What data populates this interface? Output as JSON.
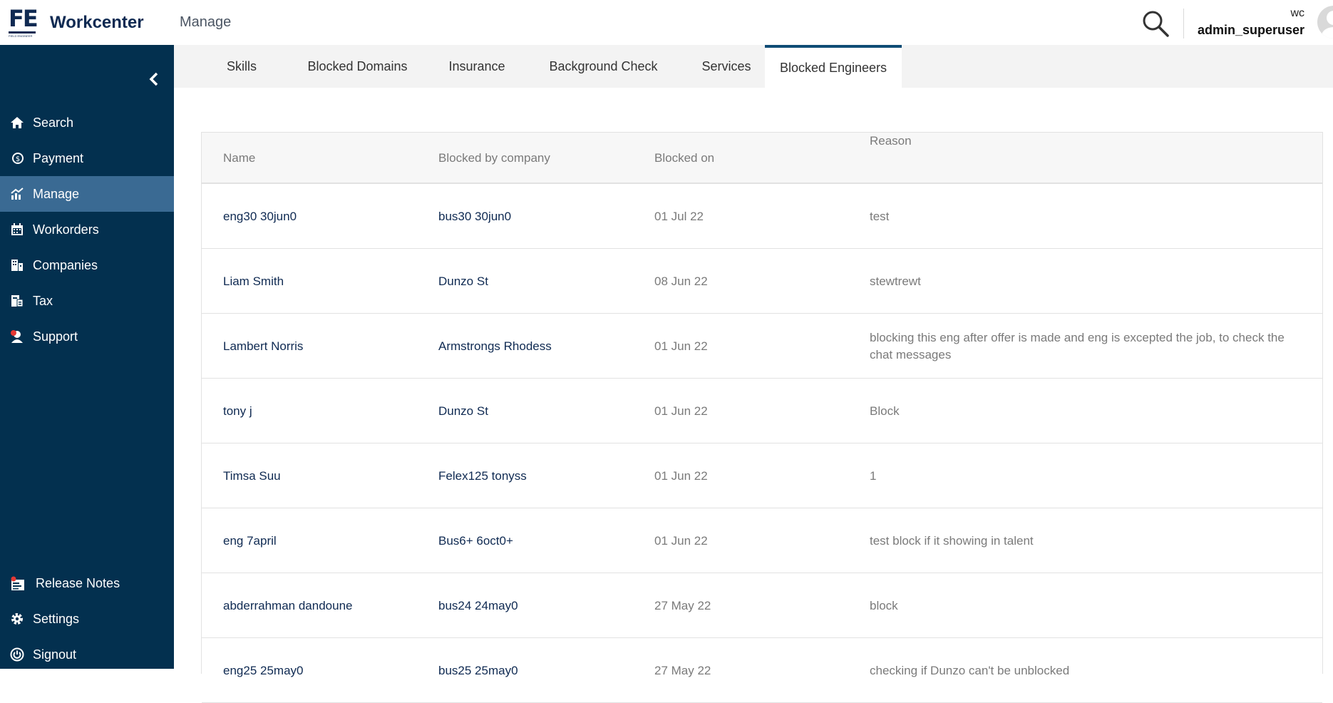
{
  "header": {
    "app_title": "Workcenter",
    "logo_text": "FE",
    "logo_sub": "FIELD ENGINEER",
    "breadcrumb": "Manage",
    "user_org": "wc",
    "user_name": "admin_superuser"
  },
  "sidebar": {
    "items": [
      {
        "label": "Search",
        "icon": "home-icon"
      },
      {
        "label": "Payment",
        "icon": "payment-icon"
      },
      {
        "label": "Manage",
        "icon": "chart-icon",
        "active": true
      },
      {
        "label": "Workorders",
        "icon": "calendar-icon"
      },
      {
        "label": "Companies",
        "icon": "companies-icon"
      },
      {
        "label": "Tax",
        "icon": "tax-icon"
      },
      {
        "label": "Support",
        "icon": "support-icon"
      }
    ],
    "bottom_items": [
      {
        "label": "Release Notes",
        "icon": "release-notes-icon"
      },
      {
        "label": "Settings",
        "icon": "gear-icon"
      },
      {
        "label": "Signout",
        "icon": "power-icon"
      }
    ]
  },
  "tabs": [
    {
      "label": "Skills"
    },
    {
      "label": "Blocked Domains"
    },
    {
      "label": "Insurance"
    },
    {
      "label": "Background Check"
    },
    {
      "label": "Services"
    },
    {
      "label": "Blocked Engineers",
      "active": true
    }
  ],
  "table": {
    "columns": [
      "Name",
      "Blocked by company",
      "Blocked on",
      "Reason"
    ],
    "rows": [
      {
        "name": "eng30 30jun0",
        "company": "bus30 30jun0",
        "date": "01 Jul 22",
        "reason": "test"
      },
      {
        "name": "Liam Smith",
        "company": "Dunzo St",
        "date": "08 Jun 22",
        "reason": "stewtrewt"
      },
      {
        "name": "Lambert Norris",
        "company": "Armstrongs Rhodess",
        "date": "01 Jun 22",
        "reason": "blocking this eng after offer is made and eng is excepted the job, to check the chat messages"
      },
      {
        "name": "tony j",
        "company": "Dunzo St",
        "date": "01 Jun 22",
        "reason": "Block"
      },
      {
        "name": "Timsa Suu",
        "company": "Felex125 tonyss",
        "date": "01 Jun 22",
        "reason": "1"
      },
      {
        "name": "eng 7april",
        "company": "Bus6+ 6oct0+",
        "date": "01 Jun 22",
        "reason": "test block if it showing in talent"
      },
      {
        "name": "abderrahman dandoune",
        "company": "bus24 24may0",
        "date": "27 May 22",
        "reason": "block"
      },
      {
        "name": "eng25 25may0",
        "company": "bus25 25may0",
        "date": "27 May 22",
        "reason": "checking if Dunzo can't be unblocked"
      }
    ]
  },
  "colors": {
    "sidebar_bg": "#03304f",
    "sidebar_active": "#3a6a93",
    "brand_navy": "#0f2a52",
    "tab_active_border": "#0f4c75"
  }
}
